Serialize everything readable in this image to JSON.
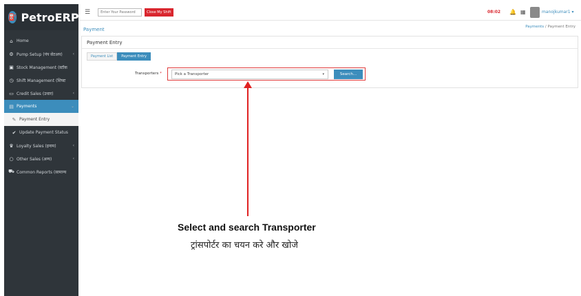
{
  "brand": {
    "name": "PetroERP",
    "logo": "fuel-logo-icon"
  },
  "sidebar": {
    "items": [
      {
        "label": "Home",
        "icon": "home-icon"
      },
      {
        "label": "Pump Setup (पंप सेटअप)",
        "icon": "cogs-icon"
      },
      {
        "label": "Stock Management (स्टॉक",
        "icon": "cubes-icon"
      },
      {
        "label": "Shift Management (शिफ्ट",
        "icon": "clock-icon"
      },
      {
        "label": "Credit Sales (उधार)",
        "icon": "card-icon"
      },
      {
        "label": "Payments",
        "icon": "money-icon"
      },
      {
        "label": "Payment Entry",
        "icon": "edit-icon"
      },
      {
        "label": "Update Payment Status",
        "icon": "check-icon"
      },
      {
        "label": "Loyalty Sales (इनाम)",
        "icon": "trophy-icon"
      },
      {
        "label": "Other Sales (अन्य)",
        "icon": "circle-icon"
      },
      {
        "label": "Common Reports (सामान्य",
        "icon": "car-icon"
      }
    ]
  },
  "topbar": {
    "password_placeholder": "Enter Your Password",
    "close_shift_label": "Close My Shift",
    "clock": "08:02",
    "username": "manojkumar1"
  },
  "page": {
    "title": "Payment",
    "breadcrumb": {
      "link": "Payments",
      "separator": "/",
      "current": "Payment Entry"
    }
  },
  "card": {
    "title": "Payment Entry",
    "tabs": [
      {
        "label": "Payment List"
      },
      {
        "label": "Payment Entry"
      }
    ],
    "form": {
      "label": "Transporters",
      "required_mark": "*",
      "select_value": "Pick a Transporter",
      "search_label": "Search..."
    }
  },
  "annotation": {
    "english": "Select and search Transporter",
    "hindi": "ट्रांसपोर्टर का चयन करे और खोजे"
  },
  "colors": {
    "sidebar": "#2f353a",
    "accent": "#3c8dbc",
    "danger": "#d9262e",
    "annotation": "#e02020"
  }
}
